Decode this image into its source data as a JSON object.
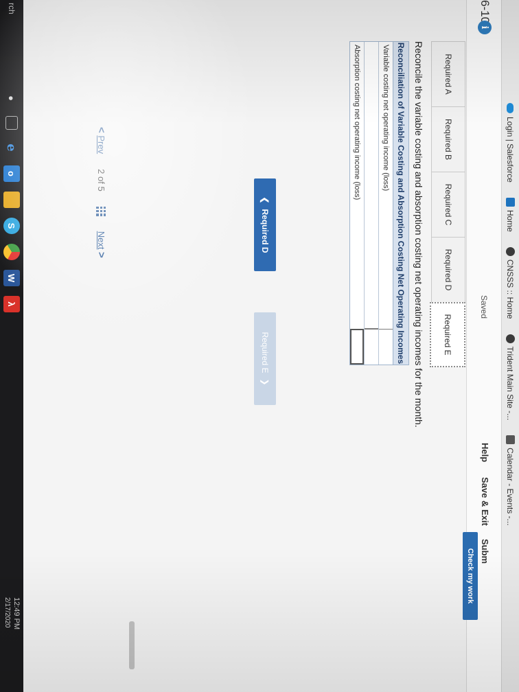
{
  "bookmarks": [
    {
      "label": "Login | Salesforce",
      "icon": "cloud-icon"
    },
    {
      "label": "Home",
      "icon": "doc-icon"
    },
    {
      "label": "CNSSS :: Home",
      "icon": "globe-icon"
    },
    {
      "label": "Trident Main Site -...",
      "icon": "globe-icon"
    },
    {
      "label": "Calendar - Events -...",
      "icon": "calendar-icon"
    }
  ],
  "header": {
    "problem_id": "6-10",
    "info": "i",
    "saved": "Saved",
    "help": "Help",
    "save_exit": "Save & Exit",
    "submit": "Subm",
    "check": "Check my work"
  },
  "tabs": [
    {
      "label": "Required A",
      "active": false
    },
    {
      "label": "Required B",
      "active": false
    },
    {
      "label": "Required C",
      "active": false
    },
    {
      "label": "Required D",
      "active": false
    },
    {
      "label": "Required E",
      "active": true
    }
  ],
  "instruction": "Reconcile the variable costing and absorption costing net operating incomes for the month.",
  "reconciliation": {
    "title": "Reconciliation of Variable Costing and Absorption Costing Net Operating Incomes",
    "rows": [
      {
        "label": "Variable costing net operating income (loss)",
        "value": ""
      },
      {
        "label": "",
        "value": ""
      },
      {
        "label": "Absorption costing net operating income (loss)",
        "value": ""
      }
    ]
  },
  "nav": {
    "prev_tab": "Required D",
    "next_tab": "Required E"
  },
  "pager": {
    "prev": "Prev",
    "current": "2",
    "of": "of",
    "total": "5",
    "next": "Next"
  },
  "taskbar": {
    "search": "rch",
    "time": "12:49 PM",
    "date": "2/17/2020"
  }
}
